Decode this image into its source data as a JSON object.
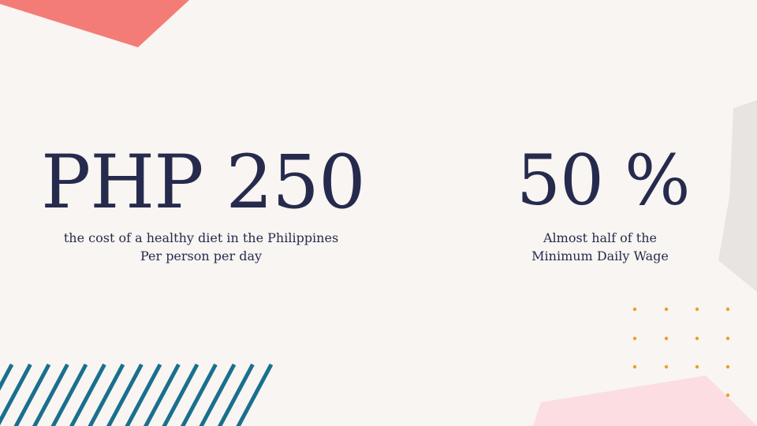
{
  "colors": {
    "background": "#f8f5f2",
    "text": "#262b4d",
    "coral": "#f47c76",
    "pink": "#fbdde2",
    "gray": "#e8e4e1",
    "teal_stripes": "#1a6f8e",
    "gold_dots": "#e5a12b"
  },
  "stats": [
    {
      "value": "PHP 250",
      "caption_line1": "the cost of a healthy diet in the Philippines",
      "caption_line2": "Per person per day"
    },
    {
      "value": "50 %",
      "caption_line1": "Almost half of the",
      "caption_line2": "Minimum Daily Wage"
    }
  ]
}
